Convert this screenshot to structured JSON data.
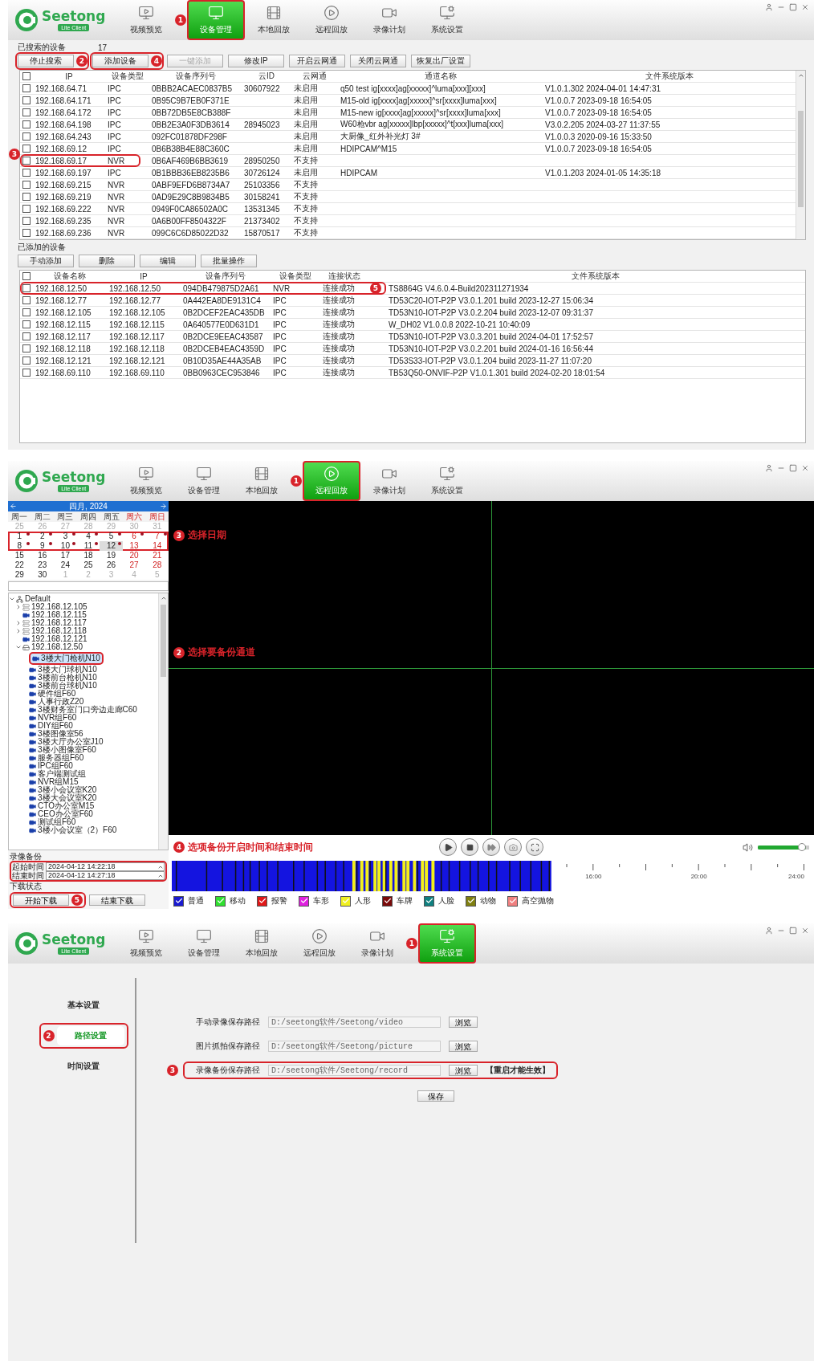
{
  "device_screen": {
    "logo": {
      "name": "Seetong",
      "edition": "Lite Client"
    },
    "nav": [
      {
        "label": "视频预览",
        "kind": "preview",
        "selected": false
      },
      {
        "label": "设备管理",
        "kind": "devices",
        "selected": true,
        "marker": "1"
      },
      {
        "label": "本地回放",
        "kind": "local",
        "selected": false
      },
      {
        "label": "远程回放",
        "kind": "remote",
        "selected": false
      },
      {
        "label": "录像计划",
        "kind": "schedule",
        "selected": false
      },
      {
        "label": "系统设置",
        "kind": "settings",
        "selected": false
      }
    ],
    "found": {
      "label": "已搜索的设备",
      "count": "17",
      "all_checked": false,
      "buttons": [
        {
          "label": "停止搜索",
          "disabled": false,
          "marker": "2"
        },
        {
          "label": "添加设备",
          "disabled": false,
          "marker": "4"
        },
        {
          "label": "一键添加",
          "disabled": true
        },
        {
          "label": "修改IP",
          "disabled": false
        },
        {
          "label": "开启云网通",
          "disabled": false
        },
        {
          "label": "关闭云网通",
          "disabled": false
        },
        {
          "label": "恢复出厂设置",
          "disabled": false
        }
      ],
      "columns": [
        "IP",
        "设备类型",
        "设备序列号",
        "云ID",
        "云网通",
        "通道名称",
        "文件系统版本"
      ],
      "rows": [
        {
          "checked": false,
          "highlighted": false,
          "ip": "192.168.64.71",
          "type": "IPC",
          "serial": "0BBB2ACAEC0837B5",
          "cloud_id": "30607922",
          "cloud_net": "未启用",
          "channel": "q50 test ig[xxxx]ag[xxxxx]^luma[xxx][xxx]",
          "firmware": "V1.0.1.302 2024-04-01 14:47:31"
        },
        {
          "checked": false,
          "highlighted": false,
          "ip": "192.168.64.171",
          "type": "IPC",
          "serial": "0B95C9B7EB0F371E",
          "cloud_net": "未启用",
          "channel": "M15-old ig[xxxx]ag[xxxxx]^sr[xxxx]luma[xxx]",
          "firmware": "V1.0.0.7 2023-09-18 16:54:05"
        },
        {
          "checked": false,
          "highlighted": false,
          "ip": "192.168.64.172",
          "type": "IPC",
          "serial": "0BB72DB5E8CB388F",
          "cloud_net": "未启用",
          "channel": "M15-new ig[xxxx]ag[xxxxx]^sr[xxxx]luma[xxx]",
          "firmware": "V1.0.0.7 2023-09-18 16:54:05"
        },
        {
          "checked": false,
          "highlighted": false,
          "ip": "192.168.64.198",
          "type": "IPC",
          "serial": "0BB2E3A0F3DB3614",
          "cloud_id": "28945023",
          "cloud_net": "未启用",
          "channel": "W60枪vbr ag[xxxxx]lbp[xxxxx]^t[xxx]luma[xxx]",
          "firmware": "V3.0.2.205 2024-03-27 11:37:55"
        },
        {
          "checked": false,
          "highlighted": false,
          "ip": "192.168.64.243",
          "type": "IPC",
          "serial": "092FC01878DF298F",
          "cloud_net": "未启用",
          "channel": "大厨像_红外补光灯 3#",
          "firmware": "V1.0.0.3 2020-09-16 15:33:50"
        },
        {
          "checked": false,
          "highlighted": false,
          "ip": "192.168.69.12",
          "type": "IPC",
          "serial": "0B6B38B4E88C360C",
          "cloud_net": "未启用",
          "channel": "HDIPCAM^M15",
          "firmware": "V1.0.0.7 2023-09-18 16:54:05"
        },
        {
          "checked": false,
          "highlighted": true,
          "marker": "3",
          "ip": "192.168.69.17",
          "type": "NVR",
          "serial": "0B6AF469B6BB3619",
          "cloud_id": "28950250",
          "cloud_net": "不支持"
        },
        {
          "checked": false,
          "highlighted": false,
          "ip": "192.168.69.197",
          "type": "IPC",
          "serial": "0B1BBB36EB8235B6",
          "cloud_id": "30726124",
          "cloud_net": "未启用",
          "channel": "HDIPCAM",
          "firmware": "V1.0.1.203 2024-01-05 14:35:18"
        },
        {
          "checked": false,
          "highlighted": false,
          "ip": "192.168.69.215",
          "type": "NVR",
          "serial": "0ABF9EFD6B8734A7",
          "cloud_id": "25103356",
          "cloud_net": "不支持"
        },
        {
          "checked": false,
          "highlighted": false,
          "ip": "192.168.69.219",
          "type": "NVR",
          "serial": "0AD9E29C8B9834B5",
          "cloud_id": "30158241",
          "cloud_net": "不支持"
        },
        {
          "checked": false,
          "highlighted": false,
          "ip": "192.168.69.222",
          "type": "NVR",
          "serial": "0949F0CA86502A0C",
          "cloud_id": "13531345",
          "cloud_net": "不支持"
        },
        {
          "checked": false,
          "highlighted": false,
          "ip": "192.168.69.235",
          "type": "NVR",
          "serial": "0A6B00FF8504322F",
          "cloud_id": "21373402",
          "cloud_net": "不支持"
        },
        {
          "checked": false,
          "highlighted": false,
          "ip": "192.168.69.236",
          "type": "NVR",
          "serial": "099C6C6D85022D32",
          "cloud_id": "15870517",
          "cloud_net": "不支持"
        }
      ]
    },
    "added": {
      "label": "已添加的设备",
      "all_checked": false,
      "buttons": [
        {
          "label": "手动添加",
          "disabled": false
        },
        {
          "label": "删除",
          "disabled": false
        },
        {
          "label": "编辑",
          "disabled": false
        },
        {
          "label": "批量操作",
          "disabled": false
        }
      ],
      "columns": [
        "设备名称",
        "IP",
        "设备序列号",
        "设备类型",
        "连接状态",
        "文件系统版本"
      ],
      "rows": [
        {
          "checked": false,
          "highlighted": true,
          "marker": "5",
          "name": "192.168.12.50",
          "ip": "192.168.12.50",
          "serial": "094DB479875D2A61",
          "type": "NVR",
          "status": "连接成功",
          "firmware": "TS8864G V4.6.0.4-Build202311271934"
        },
        {
          "checked": false,
          "highlighted": false,
          "name": "192.168.12.77",
          "ip": "192.168.12.77",
          "serial": "0A442EA8DE9131C4",
          "type": "IPC",
          "status": "连接成功",
          "firmware": "TD53C20-IOT-P2P V3.0.1.201 build 2023-12-27 15:06:34"
        },
        {
          "checked": false,
          "highlighted": false,
          "name": "192.168.12.105",
          "ip": "192.168.12.105",
          "serial": "0B2DCEF2EAC435DB",
          "type": "IPC",
          "status": "连接成功",
          "firmware": "TD53N10-IOT-P2P V3.0.2.204 build 2023-12-07 09:31:37"
        },
        {
          "checked": false,
          "highlighted": false,
          "name": "192.168.12.115",
          "ip": "192.168.12.115",
          "serial": "0A640577E0D631D1",
          "type": "IPC",
          "status": "连接成功",
          "firmware": "W_DH02 V1.0.0.8 2022-10-21 10:40:09"
        },
        {
          "checked": false,
          "highlighted": false,
          "name": "192.168.12.117",
          "ip": "192.168.12.117",
          "serial": "0B2DCE9EEAC43587",
          "type": "IPC",
          "status": "连接成功",
          "firmware": "TD53N10-IOT-P2P V3.0.3.201 build 2024-04-01 17:52:57"
        },
        {
          "checked": false,
          "highlighted": false,
          "name": "192.168.12.118",
          "ip": "192.168.12.118",
          "serial": "0B2DCEB4EAC4359D",
          "type": "IPC",
          "status": "连接成功",
          "firmware": "TD53N10-IOT-P2P V3.0.2.201 build 2024-01-16 16:56:44"
        },
        {
          "checked": false,
          "highlighted": false,
          "name": "192.168.12.121",
          "ip": "192.168.12.121",
          "serial": "0B10D35AE44A35AB",
          "type": "IPC",
          "status": "连接成功",
          "firmware": "TD53S33-IOT-P2P V3.0.1.204 build 2023-11-27 11:07:20"
        },
        {
          "checked": false,
          "highlighted": false,
          "name": "192.168.69.110",
          "ip": "192.168.69.110",
          "serial": "0BB0963CEC953846",
          "type": "IPC",
          "status": "连接成功",
          "firmware": "TB53Q50-ONVIF-P2P V1.0.1.301 build 2024-02-20 18:01:54"
        }
      ]
    }
  },
  "playback_screen": {
    "logo": {
      "name": "Seetong",
      "edition": "Lite Client"
    },
    "nav": [
      {
        "label": "视频预览",
        "kind": "preview",
        "selected": false
      },
      {
        "label": "设备管理",
        "kind": "devices",
        "selected": false
      },
      {
        "label": "本地回放",
        "kind": "local",
        "selected": false
      },
      {
        "label": "远程回放",
        "kind": "remote",
        "selected": true,
        "marker": "1"
      },
      {
        "label": "录像计划",
        "kind": "schedule",
        "selected": false
      },
      {
        "label": "系统设置",
        "kind": "settings",
        "selected": false
      }
    ],
    "calendar": {
      "title": "四月, 2024",
      "weekdays": [
        {
          "label": "周一",
          "weekend": false
        },
        {
          "label": "周二",
          "weekend": false
        },
        {
          "label": "周三",
          "weekend": false
        },
        {
          "label": "周四",
          "weekend": false
        },
        {
          "label": "周五",
          "weekend": false
        },
        {
          "label": "周六",
          "weekend": true
        },
        {
          "label": "周日",
          "weekend": true
        }
      ],
      "callout": {
        "marker": "3",
        "caption": "选择日期"
      },
      "weeks": [
        {
          "highlighted": false,
          "days": [
            {
              "day": "25",
              "kind": "other",
              "record": false,
              "selected": false
            },
            {
              "day": "26",
              "kind": "other",
              "record": false,
              "selected": false
            },
            {
              "day": "27",
              "kind": "other",
              "record": false,
              "selected": false
            },
            {
              "day": "28",
              "kind": "other",
              "record": false,
              "selected": false
            },
            {
              "day": "29",
              "kind": "other",
              "record": false,
              "selected": false
            },
            {
              "day": "30",
              "kind": "other",
              "record": false,
              "selected": false
            },
            {
              "day": "31",
              "kind": "other",
              "record": false,
              "selected": false
            }
          ]
        },
        {
          "highlighted": true,
          "days": [
            {
              "day": "1",
              "kind": "weekday",
              "record": true,
              "selected": false
            },
            {
              "day": "2",
              "kind": "weekday",
              "record": true,
              "selected": false
            },
            {
              "day": "3",
              "kind": "weekday",
              "record": true,
              "selected": false
            },
            {
              "day": "4",
              "kind": "weekday",
              "record": true,
              "selected": false
            },
            {
              "day": "5",
              "kind": "weekday",
              "record": true,
              "selected": false
            },
            {
              "day": "6",
              "kind": "weekend",
              "record": true,
              "selected": false
            },
            {
              "day": "7",
              "kind": "weekend",
              "record": true,
              "selected": false
            }
          ]
        },
        {
          "highlighted": true,
          "days": [
            {
              "day": "8",
              "kind": "weekday",
              "record": true,
              "selected": false
            },
            {
              "day": "9",
              "kind": "weekday",
              "record": true,
              "selected": false
            },
            {
              "day": "10",
              "kind": "weekday",
              "record": true,
              "selected": false
            },
            {
              "day": "11",
              "kind": "weekday",
              "record": true,
              "selected": false
            },
            {
              "day": "12",
              "kind": "weekday",
              "record": true,
              "selected": true
            },
            {
              "day": "13",
              "kind": "weekend",
              "record": false,
              "selected": false
            },
            {
              "day": "14",
              "kind": "weekend",
              "record": false,
              "selected": false
            }
          ]
        },
        {
          "highlighted": false,
          "days": [
            {
              "day": "15",
              "kind": "weekday",
              "record": false,
              "selected": false
            },
            {
              "day": "16",
              "kind": "weekday",
              "record": false,
              "selected": false
            },
            {
              "day": "17",
              "kind": "weekday",
              "record": false,
              "selected": false
            },
            {
              "day": "18",
              "kind": "weekday",
              "record": false,
              "selected": false
            },
            {
              "day": "19",
              "kind": "weekday",
              "record": false,
              "selected": false
            },
            {
              "day": "20",
              "kind": "weekend",
              "record": false,
              "selected": false
            },
            {
              "day": "21",
              "kind": "weekend",
              "record": false,
              "selected": false
            }
          ]
        },
        {
          "highlighted": false,
          "days": [
            {
              "day": "22",
              "kind": "weekday",
              "record": false,
              "selected": false
            },
            {
              "day": "23",
              "kind": "weekday",
              "record": false,
              "selected": false
            },
            {
              "day": "24",
              "kind": "weekday",
              "record": false,
              "selected": false
            },
            {
              "day": "25",
              "kind": "weekday",
              "record": false,
              "selected": false
            },
            {
              "day": "26",
              "kind": "weekday",
              "record": false,
              "selected": false
            },
            {
              "day": "27",
              "kind": "weekend",
              "record": false,
              "selected": false
            },
            {
              "day": "28",
              "kind": "weekend",
              "record": false,
              "selected": false
            }
          ]
        },
        {
          "highlighted": false,
          "days": [
            {
              "day": "29",
              "kind": "weekday",
              "record": false,
              "selected": false
            },
            {
              "day": "30",
              "kind": "weekday",
              "record": false,
              "selected": false
            },
            {
              "day": "1",
              "kind": "other",
              "record": false,
              "selected": false
            },
            {
              "day": "2",
              "kind": "other",
              "record": false,
              "selected": false
            },
            {
              "day": "3",
              "kind": "other",
              "record": false,
              "selected": false
            },
            {
              "day": "4",
              "kind": "other",
              "record": false,
              "selected": false
            },
            {
              "day": "5",
              "kind": "other",
              "record": false,
              "selected": false
            }
          ]
        }
      ]
    },
    "tree": {
      "callout": {
        "marker": "2",
        "caption": "选择要备份通道"
      },
      "nodes": [
        {
          "label": "Default",
          "kind": "root",
          "expanded": true,
          "selected": false,
          "children": [
            {
              "label": "192.168.12.105",
              "kind": "nvr",
              "expanded": false,
              "selected": false
            },
            {
              "label": "192.168.12.115",
              "kind": "camera",
              "selected": false
            },
            {
              "label": "192.168.12.117",
              "kind": "nvr",
              "expanded": false,
              "selected": false
            },
            {
              "label": "192.168.12.118",
              "kind": "nvr",
              "expanded": false,
              "selected": false
            },
            {
              "label": "192.168.12.121",
              "kind": "camera",
              "selected": false
            },
            {
              "label": "192.168.12.50",
              "kind": "recorder",
              "expanded": true,
              "selected": false,
              "children": [
                {
                  "label": "3楼大门枪机N10",
                  "kind": "channel",
                  "selected": true
                },
                {
                  "label": "3楼大门球机N10",
                  "kind": "channel",
                  "selected": false
                },
                {
                  "label": "3楼前台枪机N10",
                  "kind": "channel",
                  "selected": false
                },
                {
                  "label": "3楼前台球机N10",
                  "kind": "channel",
                  "selected": false
                },
                {
                  "label": "硬件组F60",
                  "kind": "channel",
                  "selected": false
                },
                {
                  "label": "人事行政Z20",
                  "kind": "channel",
                  "selected": false
                },
                {
                  "label": "3楼财务室门口旁边走廊C60",
                  "kind": "channel",
                  "selected": false
                },
                {
                  "label": "NVR组F60",
                  "kind": "channel",
                  "selected": false
                },
                {
                  "label": "DIY组F60",
                  "kind": "channel",
                  "selected": false
                },
                {
                  "label": "3楼图像室56",
                  "kind": "channel",
                  "selected": false
                },
                {
                  "label": "3楼大厅办公室J10",
                  "kind": "channel",
                  "selected": false
                },
                {
                  "label": "3楼小图像室F60",
                  "kind": "channel",
                  "selected": false
                },
                {
                  "label": "服务器组F60",
                  "kind": "channel",
                  "selected": false
                },
                {
                  "label": "IPC组F60",
                  "kind": "channel",
                  "selected": false
                },
                {
                  "label": "客户端测试组",
                  "kind": "channel",
                  "selected": false
                },
                {
                  "label": "NVR组M15",
                  "kind": "channel",
                  "selected": false
                },
                {
                  "label": "3楼小会议室K20",
                  "kind": "channel",
                  "selected": false
                },
                {
                  "label": "3楼大会议室K20",
                  "kind": "channel",
                  "selected": false
                },
                {
                  "label": "CTO办公室M15",
                  "kind": "channel",
                  "selected": false
                },
                {
                  "label": "CEO办公室F60",
                  "kind": "channel",
                  "selected": false
                },
                {
                  "label": "测试组F60",
                  "kind": "channel",
                  "selected": false
                },
                {
                  "label": "3楼小会议室（2）F60",
                  "kind": "channel",
                  "selected": false
                }
              ]
            }
          ]
        }
      ]
    },
    "backup": {
      "title": "录像备份",
      "start_label": "起始时间",
      "start": "2024-04-12 14:22:18",
      "end_label": "结束时间",
      "end": "2024-04-12 14:27:18",
      "status_label": "下载状态",
      "callout": {
        "marker": "4",
        "caption": "选项备份开启时间和结束时间"
      },
      "buttons": [
        {
          "label": "开始下载",
          "marker": "5"
        },
        {
          "label": "结束下载"
        }
      ]
    },
    "volume": {
      "level": 0.93
    },
    "timeline": {
      "ticks": [
        "16:00",
        "20:00",
        "24:00"
      ]
    },
    "legend": [
      {
        "label": "普通",
        "color": "#1a1ad0",
        "checked": true
      },
      {
        "label": "移动",
        "color": "#30e030",
        "checked": true
      },
      {
        "label": "报警",
        "color": "#e01818",
        "checked": true
      },
      {
        "label": "车形",
        "color": "#e020e0",
        "checked": true
      },
      {
        "label": "人形",
        "color": "#f0f020",
        "checked": true
      },
      {
        "label": "车牌",
        "color": "#7a0a0a",
        "checked": true
      },
      {
        "label": "人脸",
        "color": "#108080",
        "checked": true
      },
      {
        "label": "动物",
        "color": "#808010",
        "checked": true
      },
      {
        "label": "高空抛物",
        "color": "#f08080",
        "checked": true
      }
    ]
  },
  "settings_screen": {
    "logo": {
      "name": "Seetong",
      "edition": "Lite Client"
    },
    "nav": [
      {
        "label": "视频预览",
        "kind": "preview",
        "selected": false
      },
      {
        "label": "设备管理",
        "kind": "devices",
        "selected": false
      },
      {
        "label": "本地回放",
        "kind": "local",
        "selected": false
      },
      {
        "label": "远程回放",
        "kind": "remote",
        "selected": false
      },
      {
        "label": "录像计划",
        "kind": "schedule",
        "selected": false
      },
      {
        "label": "系统设置",
        "kind": "settings",
        "selected": true,
        "marker": "1"
      }
    ],
    "menu": [
      {
        "label": "基本设置",
        "selected": false
      },
      {
        "label": "路径设置",
        "selected": true,
        "marker": "2"
      },
      {
        "label": "时间设置",
        "selected": false
      }
    ],
    "paths": [
      {
        "label": "手动录像保存路径",
        "value": "D:/seetong软件/Seetong/video",
        "button": "浏览",
        "highlighted": false
      },
      {
        "label": "图片抓拍保存路径",
        "value": "D:/seetong软件/Seetong/picture",
        "button": "浏览",
        "highlighted": false
      },
      {
        "label": "录像备份保存路径",
        "value": "D:/seetong软件/Seetong/record",
        "button": "浏览",
        "highlighted": true,
        "marker": "3",
        "note": "【重启才能生效】"
      }
    ],
    "save": "保存"
  }
}
